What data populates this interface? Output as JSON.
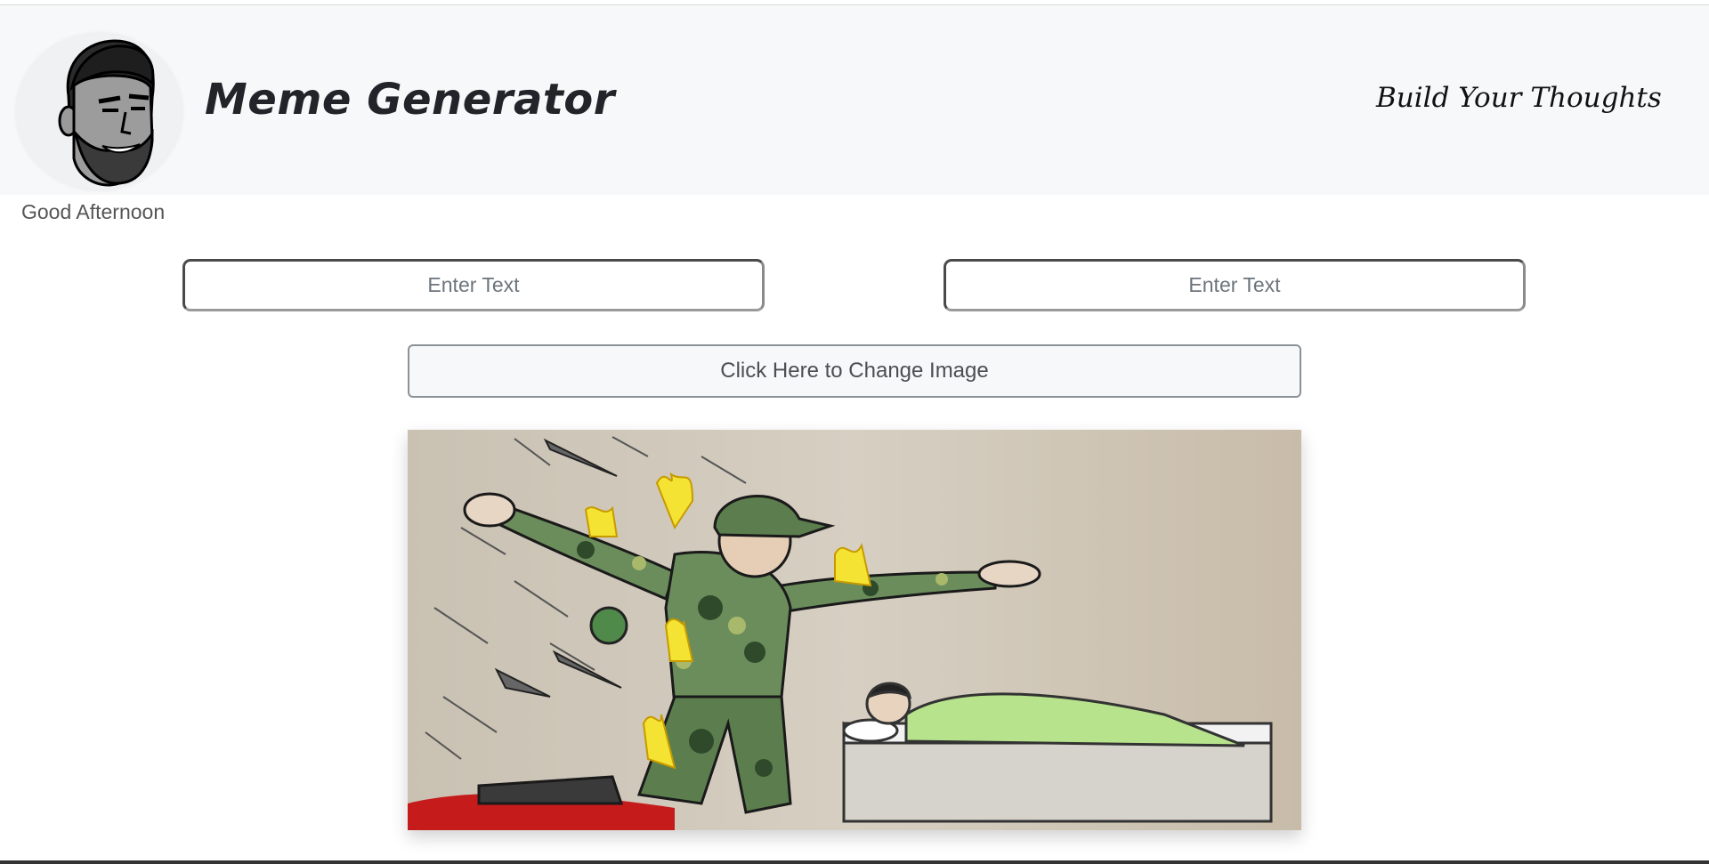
{
  "header": {
    "title": "Meme Generator",
    "tagline": "Build Your Thoughts",
    "avatar_icon": "bearded-man-avatar-icon"
  },
  "greeting": "Good Afternoon",
  "inputs": {
    "top": {
      "placeholder": "Enter Text",
      "value": ""
    },
    "bottom": {
      "placeholder": "Enter Text",
      "value": ""
    }
  },
  "change_image_button": {
    "label": "Click Here to Change Image"
  },
  "meme_image": {
    "icon": "soldier-protecting-sleeping-child-image"
  },
  "colors": {
    "header_bg": "#f7f8f9",
    "title": "#212529",
    "button_bg": "#f7f8f9",
    "button_border": "#8d9296"
  }
}
